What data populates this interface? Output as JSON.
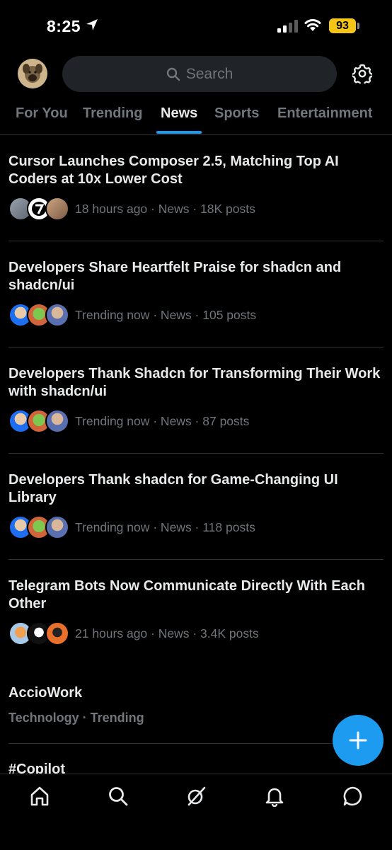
{
  "status_bar": {
    "time": "8:25",
    "battery": "93"
  },
  "search": {
    "placeholder": "Search"
  },
  "tabs": [
    {
      "label": "For You"
    },
    {
      "label": "Trending"
    },
    {
      "label": "News"
    },
    {
      "label": "Sports"
    },
    {
      "label": "Entertainment"
    }
  ],
  "active_tab": "News",
  "news": [
    {
      "title": "Cursor Launches Composer 2.5, Matching Top AI Coders at 10x Lower Cost",
      "meta": "18 hours ago · News · 18K posts"
    },
    {
      "title": "Developers Share Heartfelt Praise for shadcn and shadcn/ui",
      "meta": "Trending now · News · 105 posts"
    },
    {
      "title": "Developers Thank Shadcn for Transforming Their Work with shadcn/ui",
      "meta": "Trending now · News · 87 posts"
    },
    {
      "title": "Developers Thank shadcn for Game-Changing UI Library",
      "meta": "Trending now · News · 118 posts"
    },
    {
      "title": "Telegram Bots Now Communicate Directly With Each Other",
      "meta": "21 hours ago · News · 3.4K posts"
    }
  ],
  "trends": [
    {
      "name": "AccioWork",
      "subtitle": "Technology · Trending"
    },
    {
      "name": "#Copilot"
    }
  ],
  "icons": {
    "gear": "gear-icon",
    "search": "search-icon",
    "compose": "plus-icon",
    "nav": [
      "home-icon",
      "search-icon",
      "grok-icon",
      "bell-icon",
      "message-icon"
    ]
  },
  "colors": {
    "accent": "#1d9bf0",
    "background": "#000000",
    "battery": "#f5c518",
    "muted": "#71767b"
  }
}
